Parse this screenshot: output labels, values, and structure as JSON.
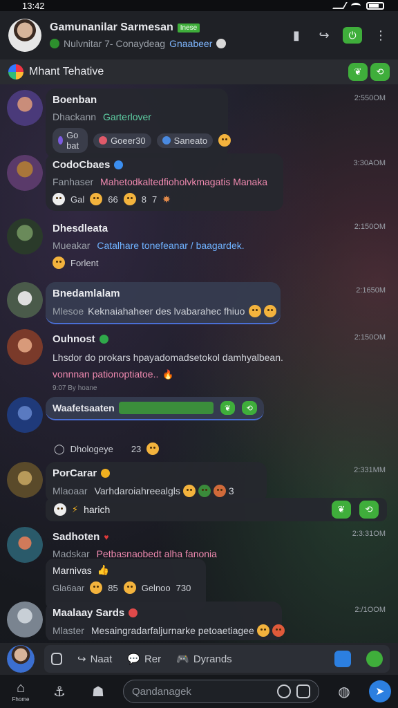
{
  "status": {
    "time": "13:42"
  },
  "header": {
    "title": "Gamunanilar Sarmesan",
    "badge": "Inese",
    "subtitle_pre": "Nulvnitar 7- Conaydeag",
    "subtitle_hl": "Gnaabeer"
  },
  "pinned": {
    "label": "Mhant Tehative"
  },
  "messages": [
    {
      "name": "Boenban",
      "prefix": "Dhackann",
      "text": "Garterlover",
      "time": "2:550OM",
      "chips": [
        "Go bat",
        "Goeer30",
        "Saneato"
      ],
      "colors": {
        "avatar": "#6a4fb0"
      }
    },
    {
      "name": "CodoCbaes",
      "prefix": "Fanhaser",
      "text": "Mahetodkaltedfioholvkmagatis Manaka",
      "time": "3:30AOM",
      "reactions": [
        "Gal",
        "66",
        "8",
        "7"
      ],
      "colors": {
        "avatar": "#8a6a2f"
      }
    },
    {
      "name": "Dhesdleata",
      "prefix": "Mueakar",
      "text": "Catalhare tonefeanar / baagardek.",
      "time": "2:150OM",
      "footer": "Forlent",
      "colors": {
        "avatar": "#3d6a3d"
      }
    },
    {
      "name": "Bnedamlalam",
      "prefix": "Mlesoe",
      "text": "Keknaiahaheer des lvabarahec fhiuo",
      "time": "2:1650M",
      "colors": {
        "avatar": "#5a6a5a"
      }
    },
    {
      "name": "Ouhnost",
      "prefix": "",
      "text": "Lhsdor do prokars hpayadomadsetokol damhyalbean.",
      "text2": "vonnnan pationoptiatoe..",
      "time": "2:150OM",
      "meta": "9:07 By hoane",
      "colors": {
        "avatar": "#9a5a3a"
      }
    },
    {
      "name": "Waafetsaaten",
      "prefix": "",
      "text": "",
      "time": "",
      "footer": "Dhologeye",
      "footer_num": "23",
      "colors": {
        "avatar": "#2f5fb0"
      }
    },
    {
      "name": "PorCarar",
      "prefix": "Mlaoaar",
      "text": "Varhdaroiahreealgls",
      "time": "2:331MM",
      "count": "3",
      "footer": "harich",
      "colors": {
        "avatar": "#7a6a2f"
      }
    },
    {
      "name": "Sadhoten",
      "prefix": "Madskar",
      "text": "Petbasnaobedt alha fanonia",
      "time": "2:3:31OM",
      "text2": "Marnivas",
      "reactions2_prefix": "Gla6aar",
      "reactions2": [
        "85",
        "Gelnoo",
        "730"
      ],
      "colors": {
        "avatar": "#3a7a8a"
      }
    },
    {
      "name": "Maalaay Sards",
      "prefix": "Mlaster",
      "text": "Mesaingradarfaljurnarke petoaetiagee",
      "time": "2:/1OOM",
      "colors": {
        "avatar": "#6a7a8a"
      }
    }
  ],
  "composer": {
    "item1": "Naat",
    "item2": "Rer",
    "item3": "Dyrands"
  },
  "nav": {
    "home": "Fhome",
    "search_placeholder": "Qandanagek"
  }
}
